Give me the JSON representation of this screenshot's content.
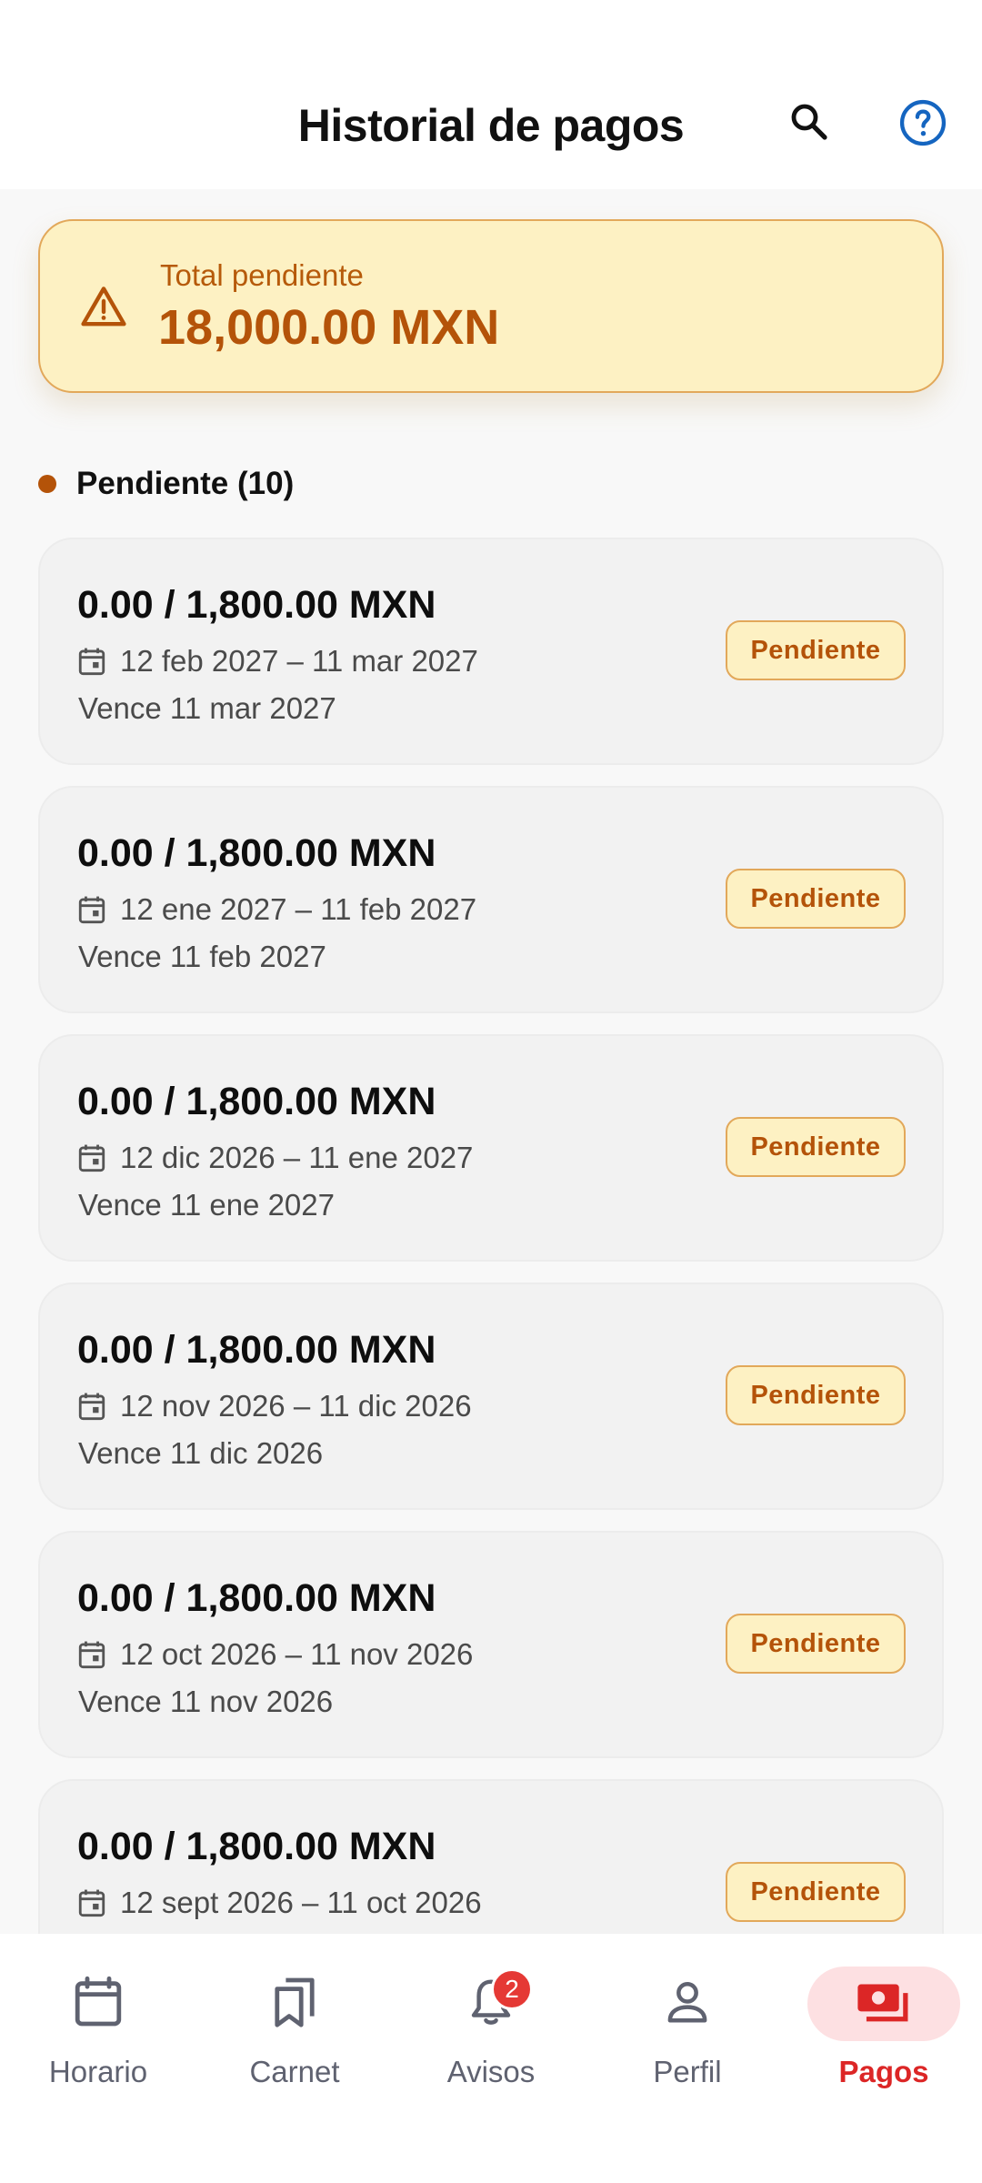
{
  "header": {
    "title": "Historial de pagos",
    "search_icon": "search-icon",
    "help_icon": "help-circle-icon"
  },
  "summary": {
    "label": "Total pendiente",
    "amount": "18,000.00 MXN",
    "icon": "warning-triangle-icon"
  },
  "section": {
    "title": "Pendiente (10)"
  },
  "payments": [
    {
      "amount": "0.00 / 1,800.00 MXN",
      "range": "12 feb 2027 – 11 mar 2027",
      "due": "Vence 11 mar 2027",
      "status": "Pendiente"
    },
    {
      "amount": "0.00 / 1,800.00 MXN",
      "range": "12 ene 2027 – 11 feb 2027",
      "due": "Vence 11 feb 2027",
      "status": "Pendiente"
    },
    {
      "amount": "0.00 / 1,800.00 MXN",
      "range": "12 dic 2026 – 11 ene 2027",
      "due": "Vence 11 ene 2027",
      "status": "Pendiente"
    },
    {
      "amount": "0.00 / 1,800.00 MXN",
      "range": "12 nov 2026 – 11 dic 2026",
      "due": "Vence 11 dic 2026",
      "status": "Pendiente"
    },
    {
      "amount": "0.00 / 1,800.00 MXN",
      "range": "12 oct 2026 – 11 nov 2026",
      "due": "Vence 11 nov 2026",
      "status": "Pendiente"
    },
    {
      "amount": "0.00 / 1,800.00 MXN",
      "range": "12 sept 2026 – 11 oct 2026",
      "due": "",
      "status": "Pendiente"
    }
  ],
  "nav": {
    "items": [
      {
        "label": "Horario",
        "icon": "calendar-icon"
      },
      {
        "label": "Carnet",
        "icon": "bookmarks-icon"
      },
      {
        "label": "Avisos",
        "icon": "bell-icon",
        "badge": "2"
      },
      {
        "label": "Perfil",
        "icon": "person-icon"
      },
      {
        "label": "Pagos",
        "icon": "payments-icon",
        "active": true
      }
    ]
  },
  "colors": {
    "accent_warning": "#b45309",
    "warning_bg": "#fdf1c3",
    "warning_border": "#e2a85a",
    "nav_active": "#dc2626",
    "nav_active_bg": "#fde0e2",
    "help_blue": "#1565c0",
    "badge_red": "#e53935"
  }
}
